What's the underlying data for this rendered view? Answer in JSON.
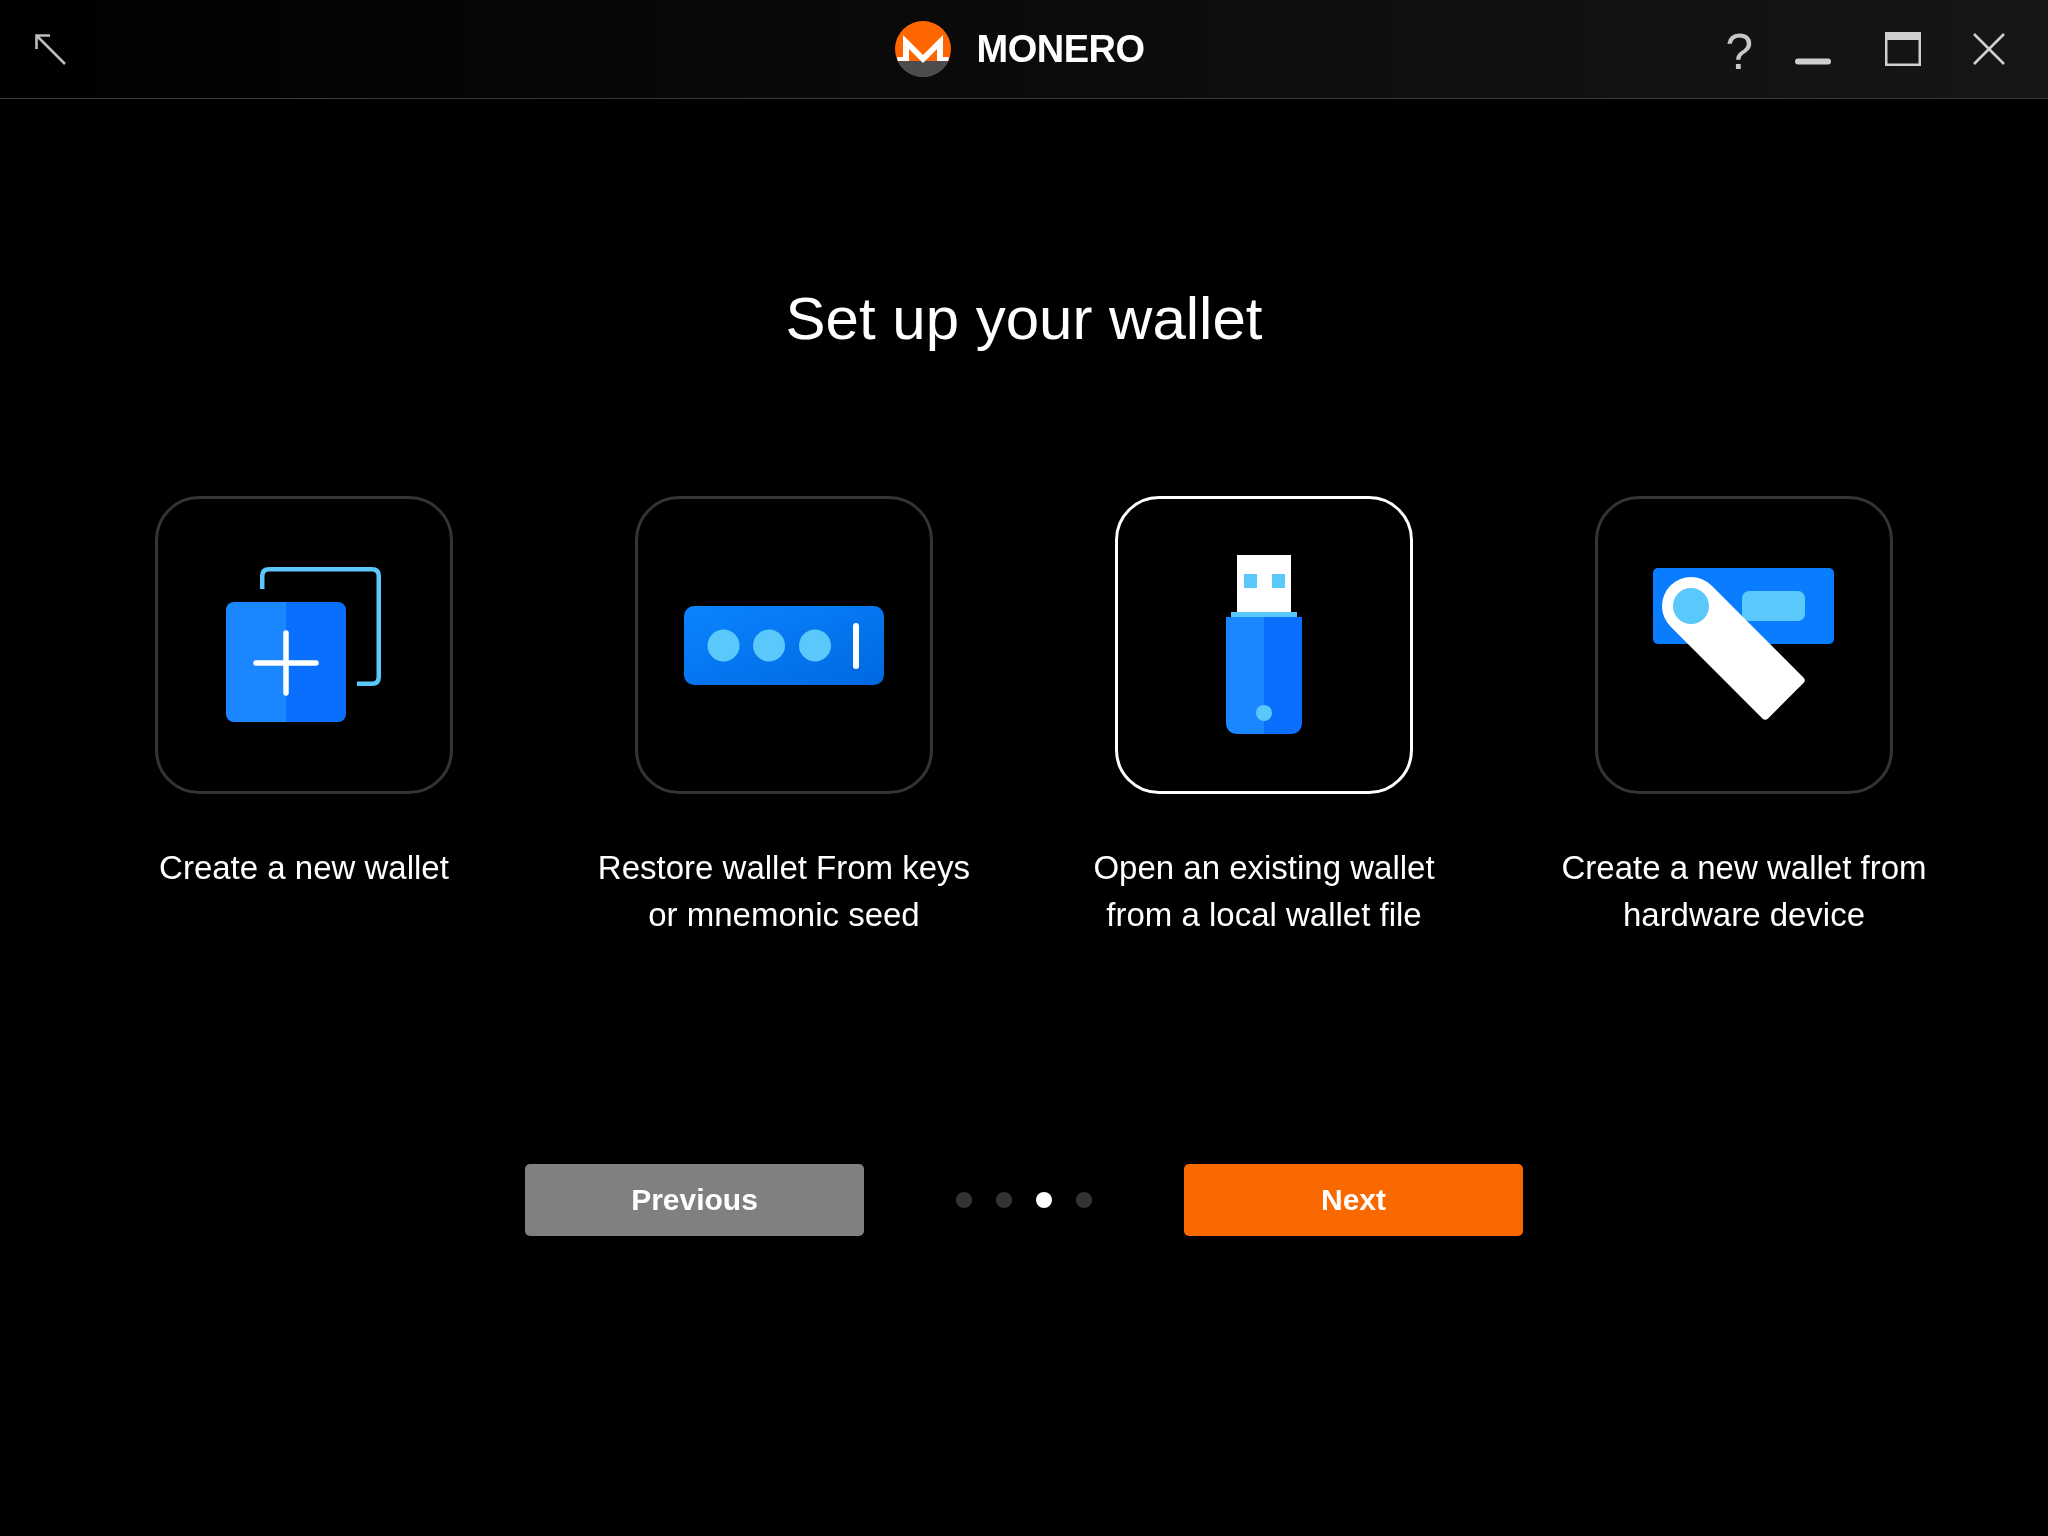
{
  "window": {
    "logo_text": "MONERO",
    "help_label": "?"
  },
  "page": {
    "title": "Set up your wallet"
  },
  "options": [
    {
      "kind": "create",
      "label": "Create a new wallet",
      "selected": false
    },
    {
      "kind": "restore",
      "label": "Restore wallet From keys or mnemonic seed",
      "selected": false
    },
    {
      "kind": "open",
      "label": "Open an existing wallet from a local wallet file",
      "selected": true
    },
    {
      "kind": "hardware",
      "label": "Create a new wallet from hardware device",
      "selected": false
    }
  ],
  "navigation": {
    "previous_button": {
      "label": "Previous",
      "kind": "secondary"
    },
    "steps": [
      {
        "selected": false
      },
      {
        "selected": false
      },
      {
        "selected": true
      },
      {
        "selected": false
      }
    ],
    "next_button": {
      "label": "Next",
      "kind": "primary"
    }
  }
}
